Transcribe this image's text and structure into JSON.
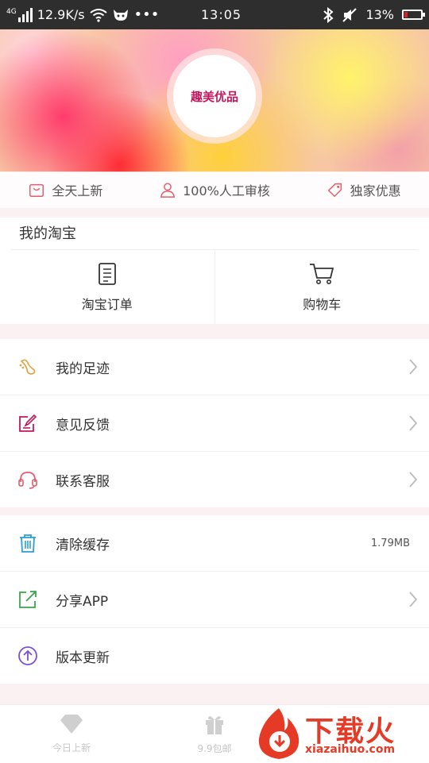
{
  "status_bar": {
    "network_type": "4G",
    "speed": "12.9K/s",
    "time": "13:05",
    "battery": "13%"
  },
  "banner": {
    "logo_text": "趣美优品"
  },
  "features": [
    {
      "icon": "shopping-bag-icon",
      "label": "全天上新"
    },
    {
      "icon": "person-icon",
      "label": "100%人工审核"
    },
    {
      "icon": "tag-icon",
      "label": "独家优惠"
    }
  ],
  "my_taobao": {
    "title": "我的淘宝",
    "actions": [
      {
        "icon": "order-list-icon",
        "label": "淘宝订单"
      },
      {
        "icon": "shopping-cart-icon",
        "label": "购物车"
      }
    ]
  },
  "menu_group_1": [
    {
      "icon": "footprint-icon",
      "label": "我的足迹",
      "color": "#e0a03a"
    },
    {
      "icon": "feedback-edit-icon",
      "label": "意见反馈",
      "color": "#c2185b"
    },
    {
      "icon": "headset-icon",
      "label": "联系客服",
      "color": "#e35d6a"
    }
  ],
  "menu_group_2": [
    {
      "icon": "trash-icon",
      "label": "清除缓存",
      "value": "1.79MB",
      "color": "#2a9fd6"
    },
    {
      "icon": "share-icon",
      "label": "分享APP",
      "color": "#3aa54b"
    },
    {
      "icon": "upgrade-icon",
      "label": "版本更新",
      "color": "#7b4fd0"
    }
  ],
  "tab_bar": [
    {
      "icon": "diamond-icon",
      "label": "今日上新"
    },
    {
      "icon": "gift-icon",
      "label": "9.9包邮"
    }
  ],
  "watermark": {
    "text": "下载火",
    "url": "xiazaihuo.com"
  },
  "colors": {
    "accent": "#c2185b",
    "background": "#fbf1f2",
    "watermark": "#e53b26"
  }
}
